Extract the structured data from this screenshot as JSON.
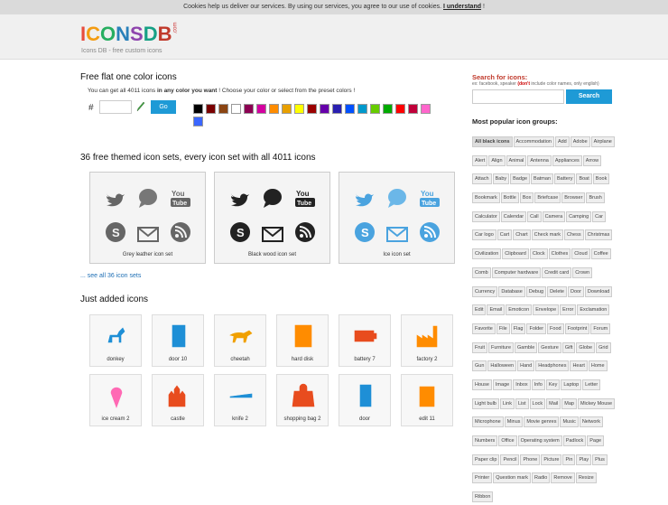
{
  "cookie": {
    "text": "Cookies help us deliver our services. By using our services, you agree to our use of cookies.",
    "link": "I understand",
    "bang": "!"
  },
  "brand": {
    "logo_letters": [
      "I",
      "C",
      "O",
      "N",
      "S",
      "D",
      "B"
    ],
    "logo_colors": [
      "#e84c3d",
      "#f39c12",
      "#27ae60",
      "#2980b9",
      "#8e44ad",
      "#16a085",
      "#c0392b"
    ],
    "com": ".com",
    "tagline": "Icons DB - free custom icons"
  },
  "color_section": {
    "title": "Free flat one color icons",
    "desc_a": "You can get all 4011 icons",
    "desc_b": "in any color you want",
    "desc_c": "! Choose your color or select from the preset colors !",
    "hash": "#",
    "go": "Go",
    "swatches": [
      "#000000",
      "#7a0000",
      "#8b4513",
      "#ffffff",
      "#8b0052",
      "#d400a0",
      "#ff8c00",
      "#e8a000",
      "#ffff00",
      "#9b0000",
      "#6600aa",
      "#2a1fb0",
      "#0050ff",
      "#0099cc",
      "#66cc00",
      "#00aa00",
      "#ff0000",
      "#c0003a",
      "#ff66cc",
      "#3a66ff"
    ]
  },
  "sets_section": {
    "title": "36 free themed icon sets, every icon set with all 4011 icons",
    "sets": [
      {
        "label": "Grey leather icon set"
      },
      {
        "label": "Black wood icon set"
      },
      {
        "label": "Ice icon set"
      }
    ],
    "see_all": "... see all 36 icon sets"
  },
  "just_added": {
    "title": "Just added icons",
    "items": [
      {
        "label": "donkey",
        "color": "#1e8fd6"
      },
      {
        "label": "door 10",
        "color": "#1e8fd6"
      },
      {
        "label": "cheetah",
        "color": "#f0a000"
      },
      {
        "label": "hard disk",
        "color": "#ff8c00"
      },
      {
        "label": "battery 7",
        "color": "#e84c1e"
      },
      {
        "label": "factory 2",
        "color": "#ff8c00"
      },
      {
        "label": "ice cream 2",
        "color": "#ff69b4"
      },
      {
        "label": "castle",
        "color": "#e84c1e"
      },
      {
        "label": "knife 2",
        "color": "#1e8fd6"
      },
      {
        "label": "shopping bag 2",
        "color": "#e84c1e"
      },
      {
        "label": "door",
        "color": "#1e8fd6"
      },
      {
        "label": "edit 11",
        "color": "#ff8c00"
      }
    ]
  },
  "sidebar": {
    "search_title": "Search for icons:",
    "search_hint_a": "ex: facebook, speaker",
    "search_hint_b": "(don't",
    "search_hint_c": "include color names, only english)",
    "search_button": "Search",
    "popular_title": "Most popular icon groups:",
    "tags": [
      "All black icons",
      "Accommodation",
      "Add",
      "Adobe",
      "Airplane",
      "Alert",
      "Align",
      "Animal",
      "Antenna",
      "Appliances",
      "Arrow",
      "Attach",
      "Baby",
      "Badge",
      "Batman",
      "Battery",
      "Boat",
      "Book",
      "Bookmark",
      "Bottle",
      "Box",
      "Briefcase",
      "Browser",
      "Brush",
      "Calculator",
      "Calendar",
      "Call",
      "Camera",
      "Camping",
      "Car",
      "Car logo",
      "Cart",
      "Chart",
      "Check mark",
      "Chess",
      "Christmas",
      "Civilization",
      "Clipboard",
      "Clock",
      "Clothes",
      "Cloud",
      "Coffee",
      "Comb",
      "Computer hardware",
      "Credit card",
      "Crown",
      "Currency",
      "Database",
      "Debug",
      "Delete",
      "Door",
      "Download",
      "Edit",
      "Email",
      "Emoticon",
      "Envelope",
      "Error",
      "Exclamation",
      "Favorite",
      "File",
      "Flag",
      "Folder",
      "Food",
      "Footprint",
      "Forum",
      "Fruit",
      "Furniture",
      "Gamble",
      "Gesture",
      "Gift",
      "Globe",
      "Grid",
      "Gun",
      "Halloween",
      "Hand",
      "Headphones",
      "Heart",
      "Home",
      "House",
      "Image",
      "Inbox",
      "Info",
      "Key",
      "Laptop",
      "Letter",
      "Light bulb",
      "Link",
      "List",
      "Lock",
      "Mail",
      "Map",
      "Mickey Mouse",
      "Microphone",
      "Minus",
      "Movie genres",
      "Music",
      "Network",
      "Numbers",
      "Office",
      "Operating system",
      "Padlock",
      "Page",
      "Paper clip",
      "Pencil",
      "Phone",
      "Picture",
      "Pin",
      "Play",
      "Plus",
      "Printer",
      "Question mark",
      "Radio",
      "Remove",
      "Resize",
      "Ribbon"
    ]
  }
}
